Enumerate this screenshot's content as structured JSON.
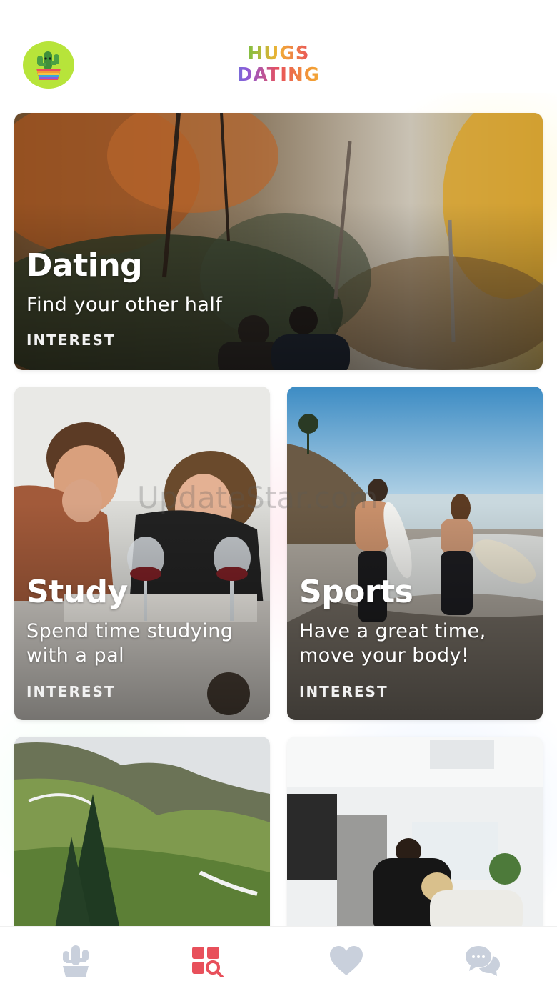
{
  "header": {
    "logo_line1": "HUGS",
    "logo_line2": "DATING",
    "avatar_icon": "cactus-cup-icon"
  },
  "cards": [
    {
      "title": "Dating",
      "description": "Find your other half",
      "tag": "INTEREST"
    },
    {
      "title": "Study",
      "description_line1": "Spend time studying",
      "description_line2": "with a pal",
      "tag": "INTEREST"
    },
    {
      "title": "Sports",
      "description_line1": "Have a great time,",
      "description_line2": "move your body!",
      "tag": "INTEREST"
    }
  ],
  "watermark": "UpdateStar.com",
  "bottom_nav": {
    "items": [
      {
        "icon": "cactus-icon",
        "active": false
      },
      {
        "icon": "explore-grid-icon",
        "active": true
      },
      {
        "icon": "heart-icon",
        "active": false
      },
      {
        "icon": "chat-bubbles-icon",
        "active": false
      }
    ],
    "active_color": "#e8505b",
    "inactive_color": "#c9d0dc"
  }
}
